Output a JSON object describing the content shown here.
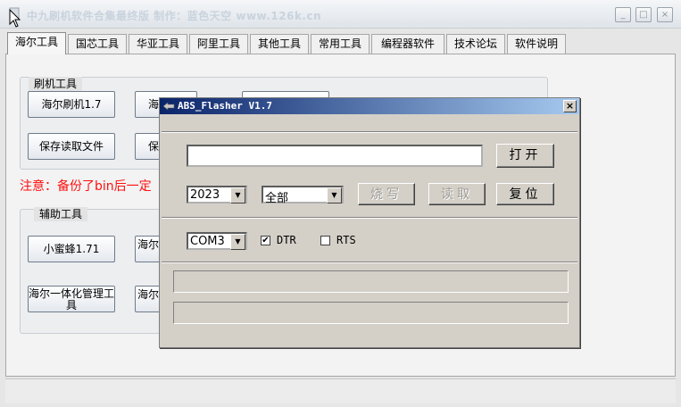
{
  "window": {
    "title": "中九刷机软件合集最终版 制作：蓝色天空 www.126k.cn",
    "minimize": "_",
    "maximize": "□",
    "close": "×"
  },
  "tabs": [
    "海尔工具",
    "国芯工具",
    "华亚工具",
    "阿里工具",
    "其他工具",
    "常用工具",
    "编程器软件",
    "技术论坛",
    "软件说明"
  ],
  "flash_group": {
    "legend": "刷机工具",
    "buttons": [
      "海尔刷机1.7",
      "海",
      "保存读取文件",
      "保"
    ]
  },
  "warning": "注意：备份了bin后一定",
  "aux_group": {
    "legend": "辅助工具",
    "buttons": [
      "小蜜蜂1.71",
      "海尔",
      "海尔一体化管理工具",
      "海尔"
    ]
  },
  "dialog": {
    "title": "ABS_Flasher V1.7",
    "close": "×",
    "file_path": "",
    "open_label": "打开",
    "year_value": "2023",
    "mode_value": "全部",
    "burn_label": "烧写",
    "read_label": "读取",
    "reset_label": "复位",
    "port_value": "COM3",
    "dtr_label": "DTR",
    "rts_label": "RTS",
    "dtr_checked": true,
    "rts_checked": false,
    "status_line1": "",
    "status_line2": ""
  }
}
